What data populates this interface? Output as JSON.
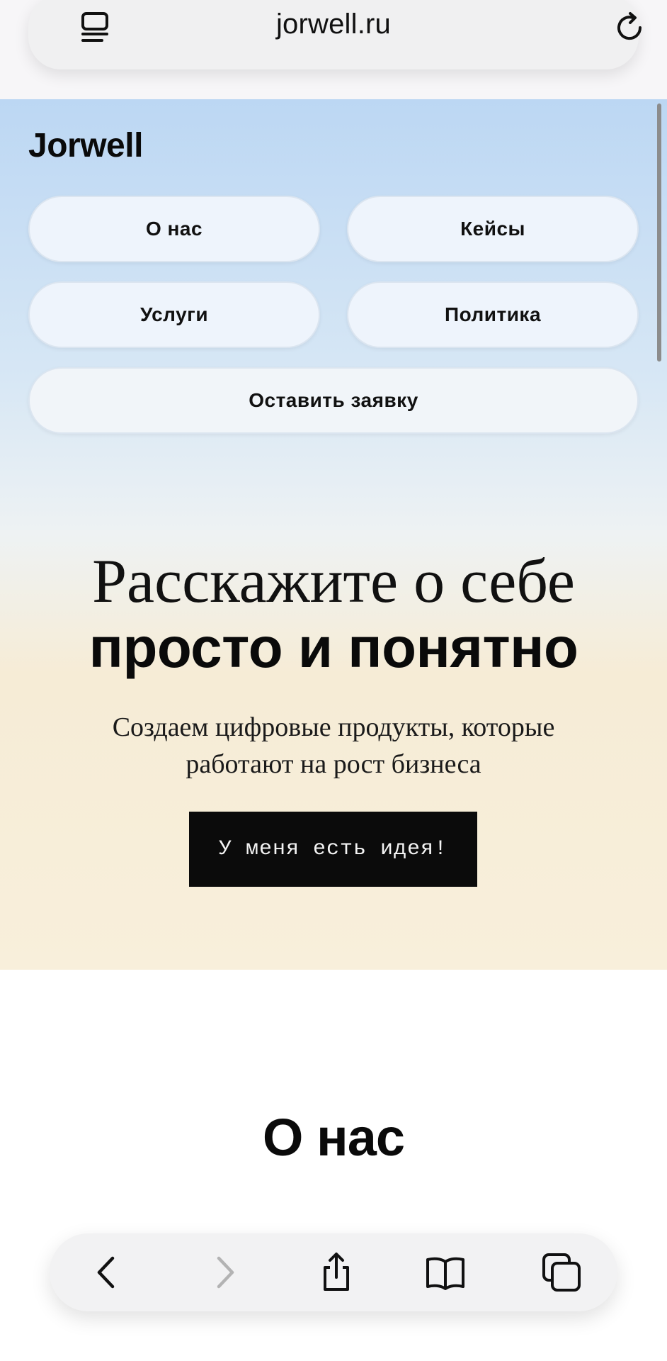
{
  "browser": {
    "url": "jorwell.ru",
    "icons": {
      "left": "reader-icon",
      "right": "reload-icon"
    }
  },
  "site": {
    "brand": "Jorwell",
    "nav": {
      "about": "О нас",
      "cases": "Кейсы",
      "services": "Услуги",
      "policy": "Политика",
      "request": "Оставить заявку"
    },
    "hero": {
      "title_line1": "Расскажите о себе",
      "title_line2": "просто и понятно",
      "subtitle_line1": "Создаем цифровые продукты, которые",
      "subtitle_line2": "работают на рост бизнеса",
      "cta": "У меня есть идея!"
    },
    "about": {
      "title": "О нас"
    }
  },
  "toolbar": {
    "icons": [
      "back-icon",
      "forward-icon",
      "share-icon",
      "bookmarks-icon",
      "tabs-icon"
    ]
  }
}
